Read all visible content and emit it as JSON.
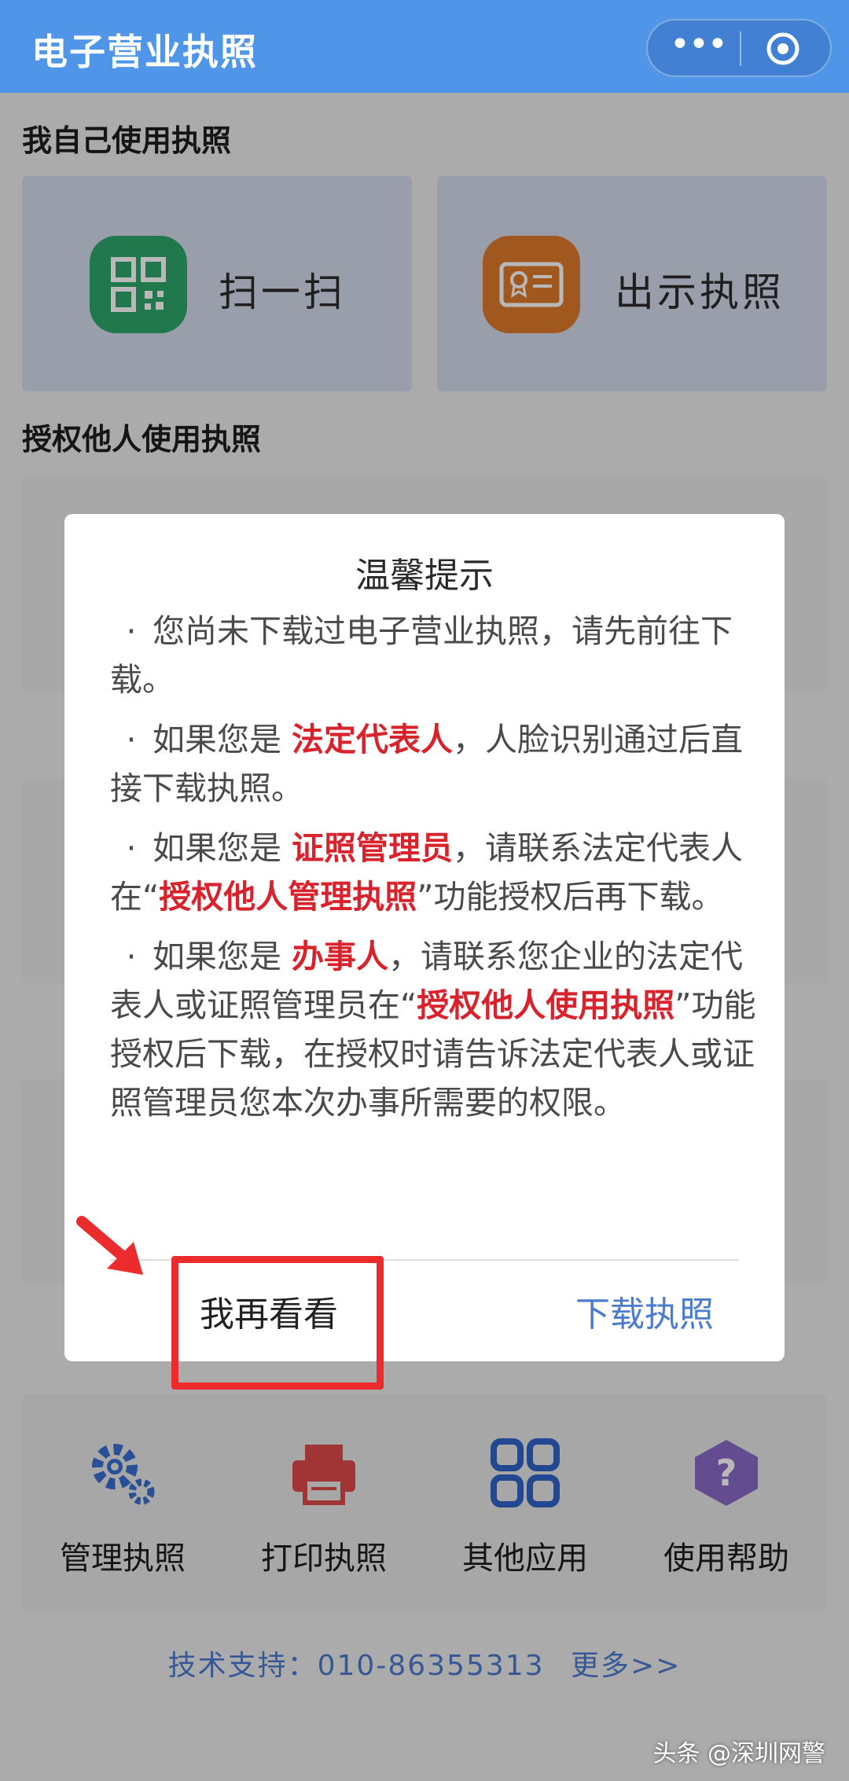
{
  "header": {
    "title": "电子营业执照",
    "more_icon": "ellipsis-icon",
    "close_icon": "target-icon"
  },
  "self_section": {
    "title": "我自己使用执照",
    "scan_label": "扫一扫",
    "scan_icon": "qr-code-icon",
    "show_label": "出示执照",
    "show_icon": "license-card-icon"
  },
  "authorize_section": {
    "title": "授权他人使用执照"
  },
  "tools": [
    {
      "label": "管理执照",
      "icon": "gears-icon"
    },
    {
      "label": "打印执照",
      "icon": "printer-icon"
    },
    {
      "label": "其他应用",
      "icon": "grid-apps-icon"
    },
    {
      "label": "使用帮助",
      "icon": "help-question-icon"
    }
  ],
  "support": {
    "text": "技术支持：010-86355313",
    "more": "更多>>"
  },
  "modal": {
    "title": "温馨提示",
    "tip1": {
      "text": "您尚未下载过电子营业执照，请先前往下载。"
    },
    "tip2": {
      "pre": "如果您是",
      "role": "法定代表人",
      "post": "，人脸识别通过后直接下载执照。"
    },
    "tip3": {
      "pre": "如果您是",
      "role": "证照管理员",
      "mid": "，请联系法定代表人在“",
      "func": "授权他人管理执照",
      "post": "”功能授权后再下载。"
    },
    "tip4": {
      "pre": "如果您是",
      "role": "办事人",
      "mid": "，请联系您企业的法定代表人或证照管理员在“",
      "func": "授权他人使用执照",
      "post": "”功能授权后下载，在授权时请告诉法定代表人或证照管理员您本次办事所需要的权限。"
    },
    "cancel_label": "我再看看",
    "confirm_label": "下载执照"
  },
  "colors": {
    "header": "#4f95e8",
    "accent_red": "#d9232c",
    "link_blue": "#4b7bd0",
    "annotation_red": "#ec2c2c"
  },
  "watermark": "头条 @深圳网警"
}
